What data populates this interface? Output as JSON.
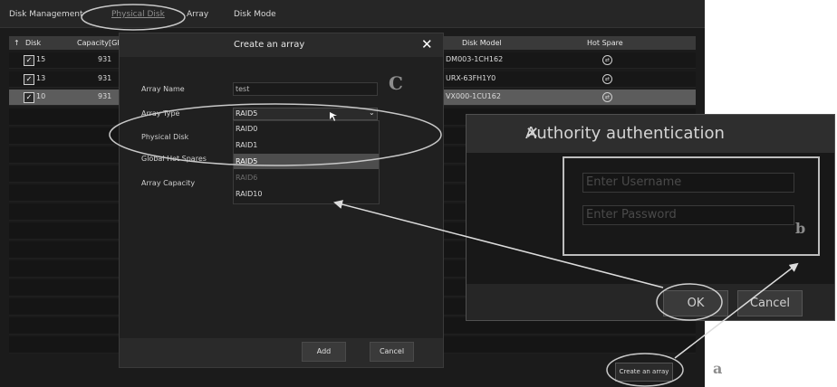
{
  "topbar": {
    "tabs": [
      "Disk Management",
      "Physical Disk",
      "Array",
      "Disk Mode"
    ],
    "active_tab": "Physical Disk"
  },
  "table": {
    "columns": [
      "Disk",
      "Capacity[GI",
      "Disk Model",
      "Hot Spare"
    ],
    "sort_arrow": "↑",
    "rows": [
      {
        "disk": "15",
        "capacity": "931",
        "model": "DM003-1CH162",
        "checked": true,
        "selected": false
      },
      {
        "disk": "13",
        "capacity": "931",
        "model": "URX-63FH1Y0",
        "checked": true,
        "selected": false
      },
      {
        "disk": "10",
        "capacity": "931",
        "model": "VX000-1CU162",
        "checked": true,
        "selected": true
      }
    ]
  },
  "dialog": {
    "title": "Create an array",
    "close": "✕",
    "labels": {
      "array_name": "Array Name",
      "array_type": "Array Type",
      "physical_disk": "Physical Disk",
      "global_hot_spares": "Global Hot Spares",
      "array_capacity": "Array Capacity"
    },
    "array_name_value": "test",
    "array_type_value": "RAID5",
    "options": [
      "RAID0",
      "RAID1",
      "RAID5",
      "RAID6",
      "RAID10"
    ],
    "highlighted_option": "RAID5",
    "buttons": {
      "add": "Add",
      "cancel": "Cancel"
    }
  },
  "auth": {
    "title": "Authority authentication",
    "close": "✕",
    "username_placeholder": "Enter Username",
    "password_placeholder": "Enter Password",
    "buttons": {
      "ok": "OK",
      "cancel": "Cancel"
    }
  },
  "create_button": "Create an array",
  "annotations": {
    "a": "a",
    "b": "b",
    "c": "C"
  }
}
